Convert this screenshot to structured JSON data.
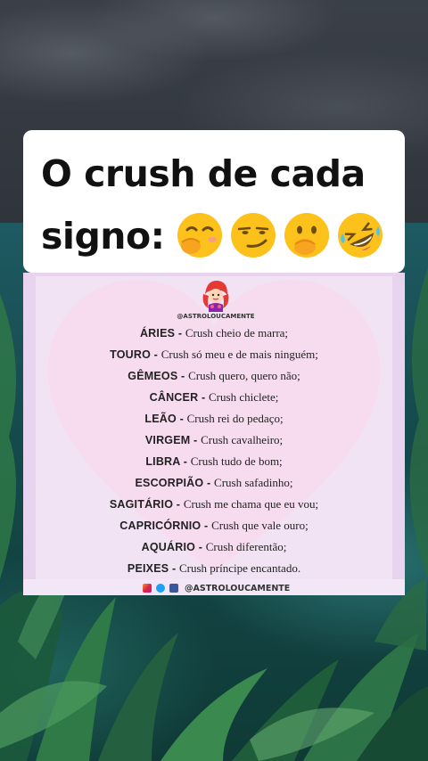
{
  "title": {
    "line1": "O crush de cada",
    "line2": "signo:"
  },
  "title_emojis": [
    "hand-over-mouth-emoji",
    "smirk-emoji",
    "hand-over-mouth-emoji",
    "rolling-laughing-emoji"
  ],
  "brand": {
    "handle_small": "@ASTROLOUCAMENTE",
    "handle_footer": "@ASTROLOUCAMENTE",
    "social_icons": [
      "instagram-icon",
      "twitter-icon",
      "facebook-icon"
    ]
  },
  "signs": [
    {
      "name": "ÁRIES - ",
      "desc": " Crush cheio de marra;"
    },
    {
      "name": "TOURO - ",
      "desc": "Crush só meu e de mais ninguém;"
    },
    {
      "name": "GÊMEOS - ",
      "desc": "Crush quero, quero não;"
    },
    {
      "name": "CÂNCER - ",
      "desc": "Crush chiclete;"
    },
    {
      "name": "LEÃO - ",
      "desc": " Crush rei do pedaço;"
    },
    {
      "name": "VIRGEM - ",
      "desc": "Crush cavalheiro;"
    },
    {
      "name": "LIBRA - ",
      "desc": "Crush tudo de bom;"
    },
    {
      "name": "ESCORPIÃO - ",
      "desc": "Crush safadinho;"
    },
    {
      "name": "SAGITÁRIO - ",
      "desc": "Crush me chama que eu vou;"
    },
    {
      "name": "CAPRICÓRNIO - ",
      "desc": "Crush que vale ouro;"
    },
    {
      "name": "AQUÁRIO - ",
      "desc": "Crush diferentão;"
    },
    {
      "name": "PEIXES - ",
      "desc": "Crush príncipe encantado."
    }
  ],
  "colors": {
    "panel_bg": "#e8d4ee",
    "heart": "#f7dcef",
    "title_card": "#ffffff"
  }
}
